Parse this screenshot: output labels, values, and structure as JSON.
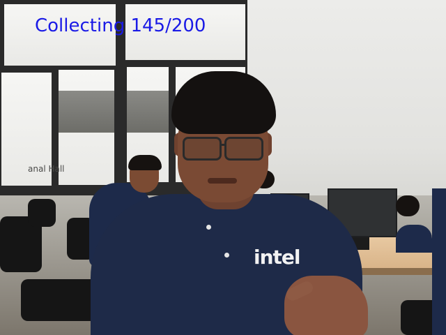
{
  "overlay": {
    "status_text": "Collecting 145/200",
    "color": "#1a1ae6",
    "progress": {
      "collected": 145,
      "total": 200
    }
  },
  "scene": {
    "wall_sign_text": "anal Hall",
    "shirt_logo_text": "intel"
  }
}
